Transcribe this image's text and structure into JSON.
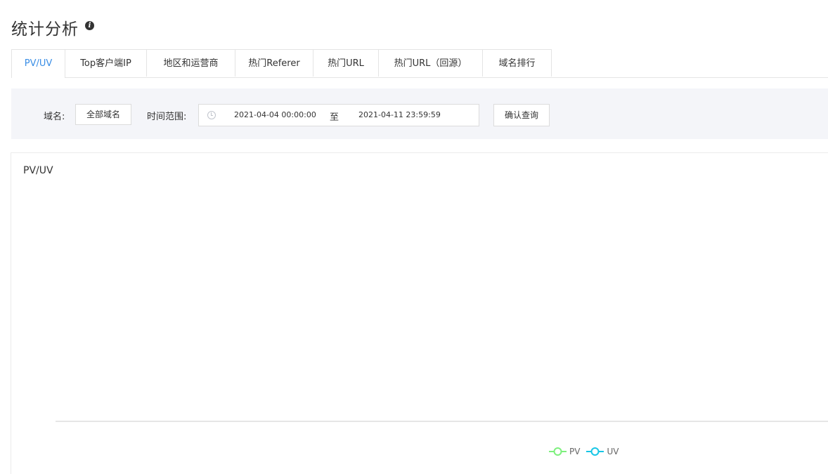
{
  "page": {
    "title": "统计分析",
    "info_icon": "i"
  },
  "tabs": [
    {
      "label": "PV/UV",
      "active": true
    },
    {
      "label": "Top客户端IP",
      "active": false
    },
    {
      "label": "地区和运营商",
      "active": false
    },
    {
      "label": "热门Referer",
      "active": false
    },
    {
      "label": "热门URL",
      "active": false
    },
    {
      "label": "热门URL（回源）",
      "active": false
    },
    {
      "label": "域名排行",
      "active": false
    }
  ],
  "filters": {
    "domain_label": "域名:",
    "domain_button": "全部域名",
    "time_label": "时间范围:",
    "start_time": "2021-04-04 00:00:00",
    "separator": "至",
    "end_time": "2021-04-11 23:59:59",
    "query_button": "确认查询"
  },
  "chart_data": {
    "type": "line",
    "title": "PV/UV",
    "categories": [],
    "series": [
      {
        "name": "PV",
        "color": "#7df07d",
        "values": []
      },
      {
        "name": "UV",
        "color": "#17c6e6",
        "values": []
      }
    ],
    "legend_placement": "bottom-center",
    "grid": false
  },
  "colors": {
    "accent": "#3a8ee6",
    "filter_background": "#f4f5f9"
  }
}
